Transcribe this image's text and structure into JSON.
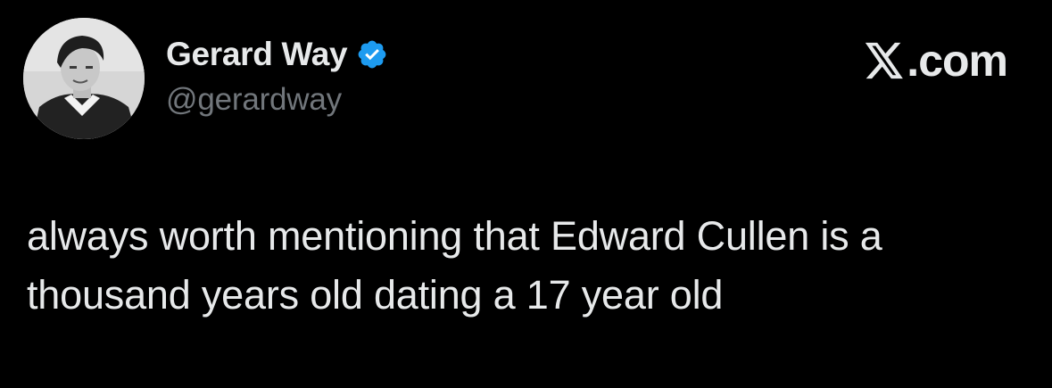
{
  "author": {
    "display_name": "Gerard Way",
    "handle": "@gerardway",
    "verified": true
  },
  "brand": {
    "name": ".com",
    "icon": "x-logo-icon"
  },
  "tweet": {
    "text": "always worth mentioning that Edward Cullen is a thousand years old dating a 17 year old"
  },
  "colors": {
    "background": "#000000",
    "primary_text": "#e7e9ea",
    "secondary_text": "#71767b",
    "verified_blue": "#1d9bf0"
  }
}
